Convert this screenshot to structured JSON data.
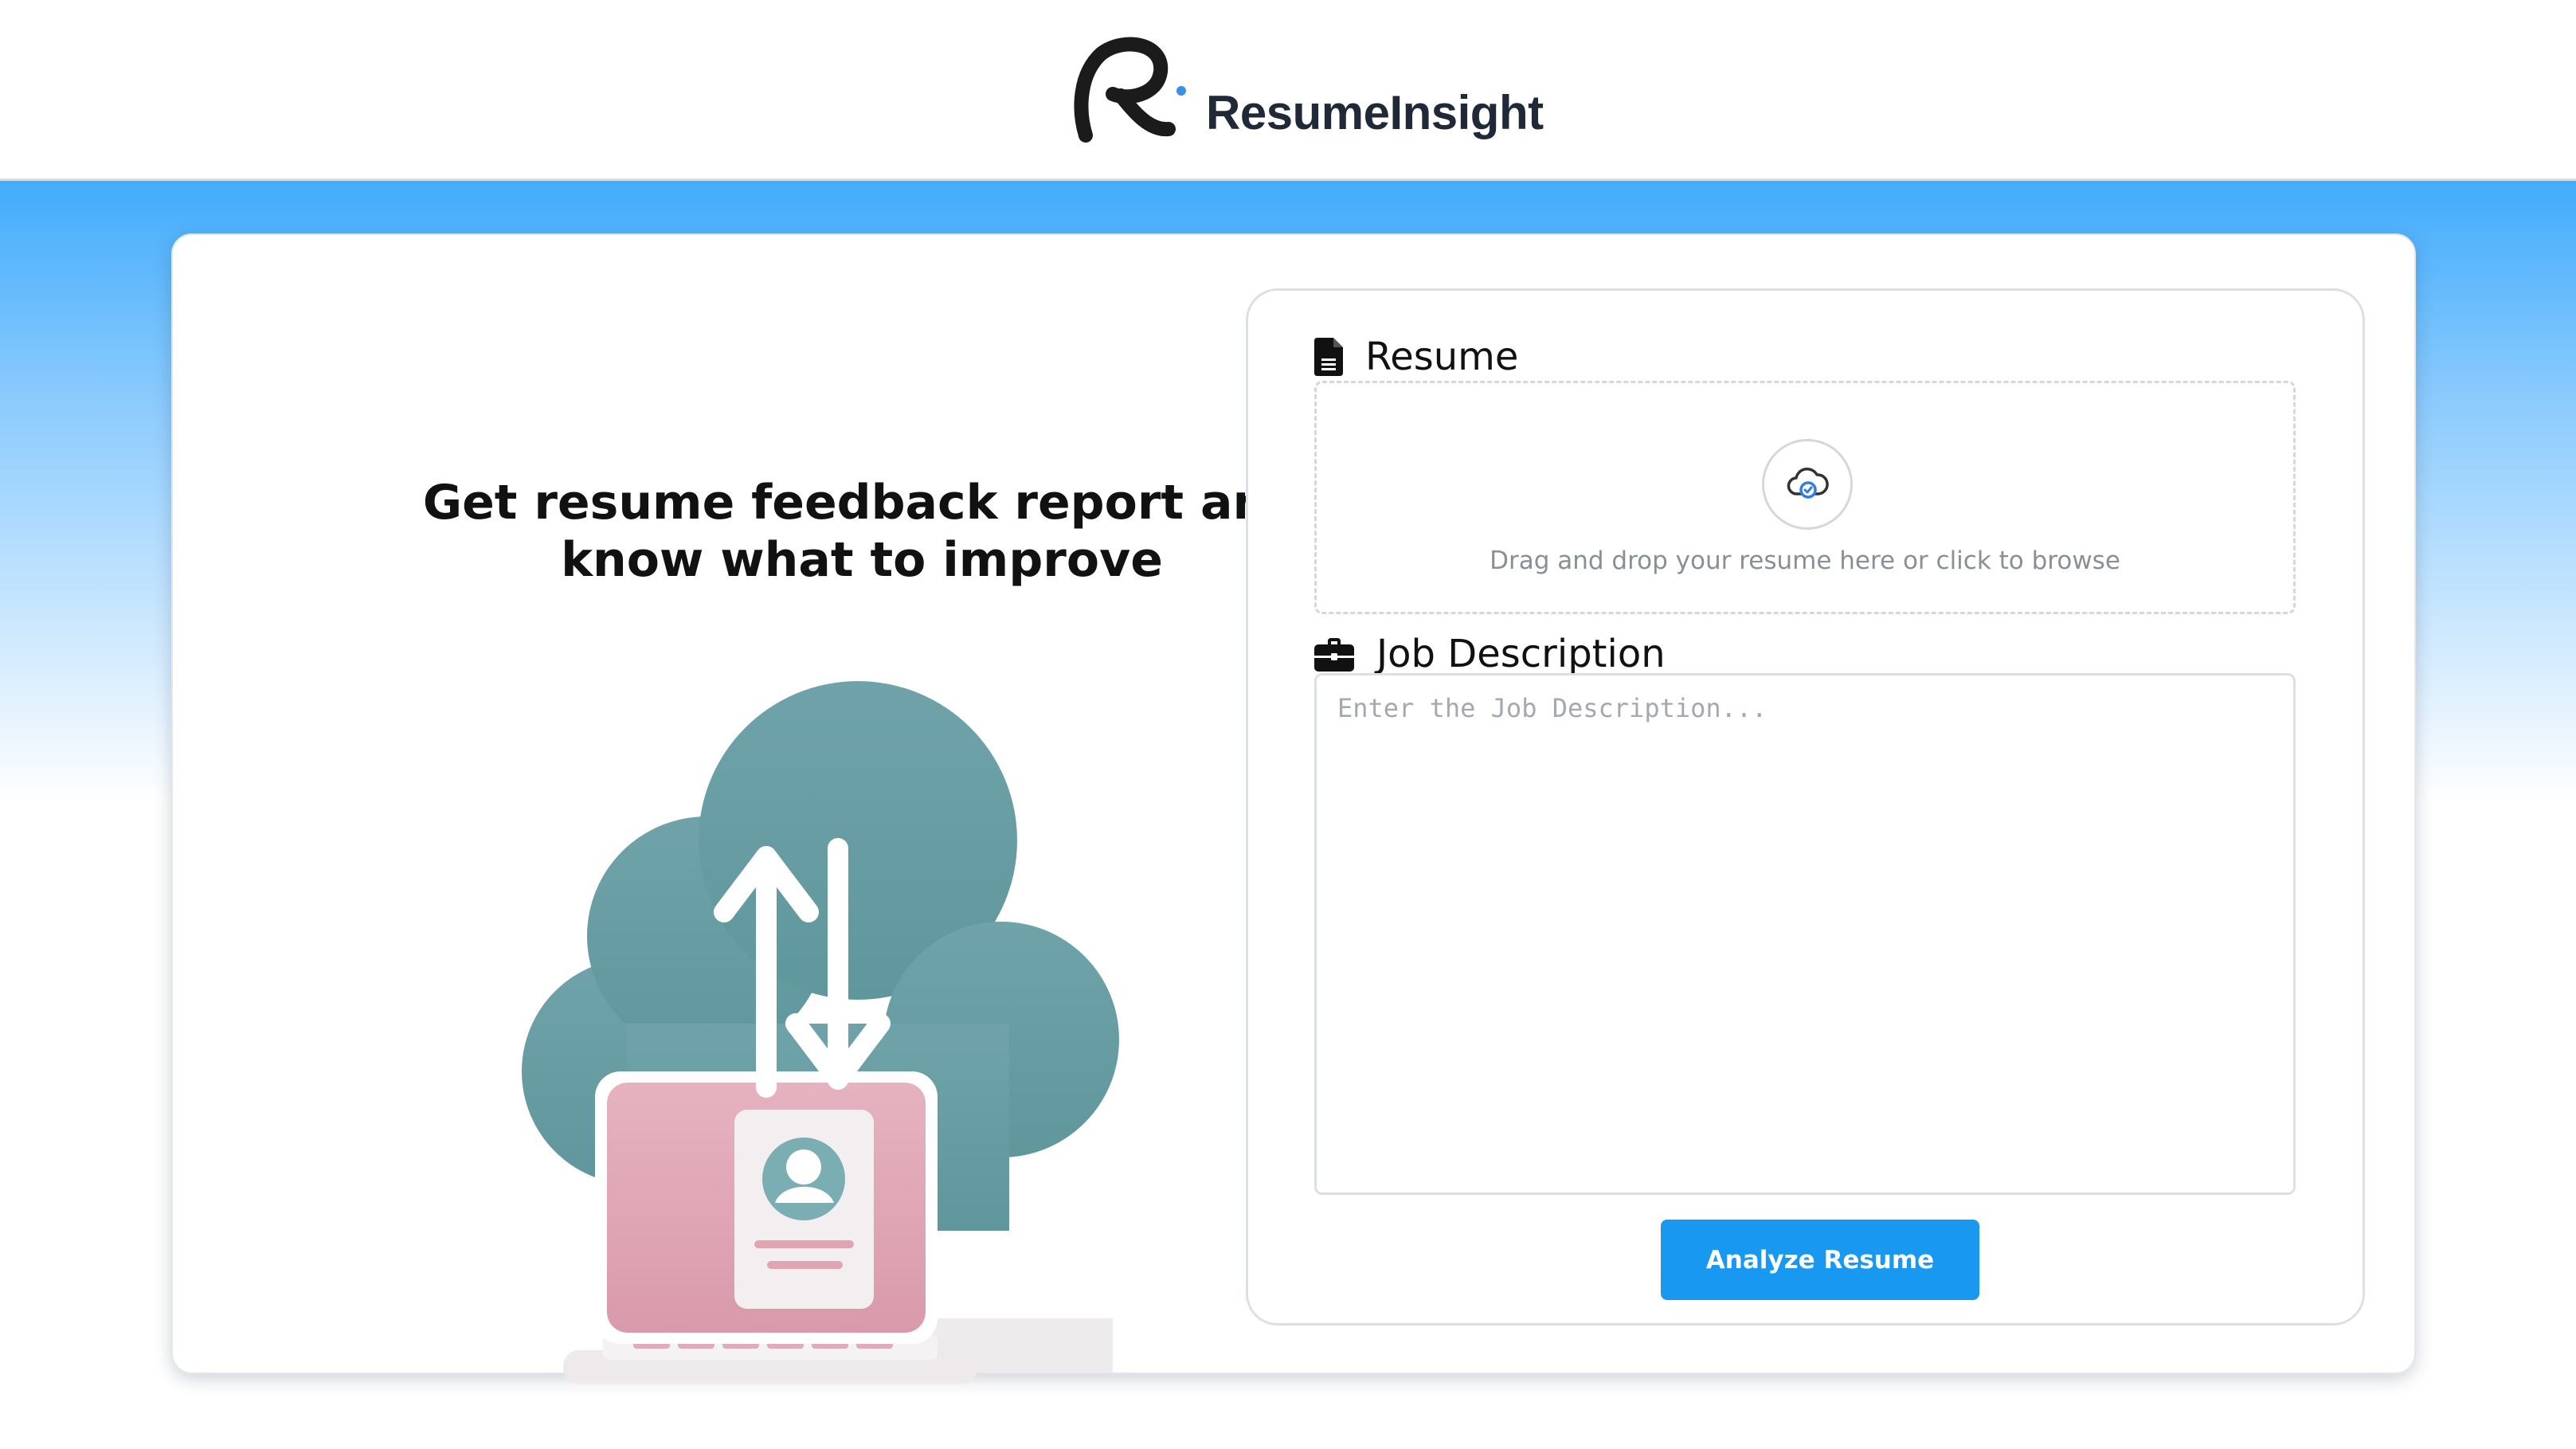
{
  "header": {
    "brand_name": "ResumeInsight",
    "logo_icon": "ri-monogram-logo"
  },
  "hero": {
    "tagline_line1": "Get resume feedback report and",
    "tagline_line2": "know what to improve",
    "illustration": "cloud-laptop-resume-upload-illustration"
  },
  "form": {
    "resume": {
      "label": "Resume",
      "icon": "document-icon",
      "dropzone_icon": "cloud-upload-icon",
      "dropzone_text": "Drag and drop your resume here or click to browse"
    },
    "job_description": {
      "label": "Job Description",
      "icon": "briefcase-icon",
      "value": "",
      "placeholder": "Enter the Job Description..."
    },
    "submit_label": "Analyze Resume"
  },
  "colors": {
    "brand_text": "#1f2937",
    "accent": "#1898f0",
    "gradient_top": "#42acfc",
    "logo_dot": "#3b8fe8"
  }
}
